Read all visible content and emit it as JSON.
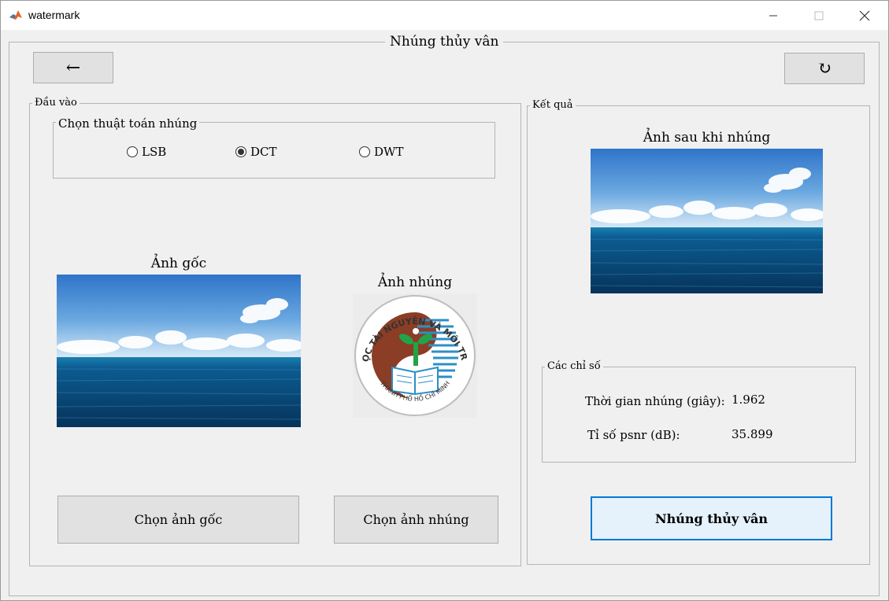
{
  "window": {
    "title": "watermark"
  },
  "main": {
    "title": "Nhúng thủy vân",
    "back_glyph": "←",
    "refresh_glyph": "↻"
  },
  "input_panel": {
    "title": "Đầu vào",
    "algorithm_group": {
      "title": "Chọn thuật toán nhúng",
      "options": [
        "LSB",
        "DCT",
        "DWT"
      ],
      "selected": "DCT"
    },
    "original_caption": "Ảnh gốc",
    "watermark_caption": "Ảnh nhúng",
    "logo_text_top": "ĐẠI HỌC TÀI NGUYÊN VÀ MÔI TRƯỜNG",
    "logo_text_bottom": "THÀNH PHỐ HỒ CHÍ MINH",
    "choose_original_label": "Chọn ảnh gốc",
    "choose_watermark_label": "Chọn ảnh nhúng"
  },
  "result_panel": {
    "title": "Kết quả",
    "result_caption": "Ảnh sau khi nhúng",
    "metrics_group": {
      "title": "Các chỉ số",
      "time_label": "Thời gian nhúng (giây):",
      "time_value": "1.962",
      "psnr_label": "Tỉ số psnr (dB):",
      "psnr_value": "35.899"
    },
    "embed_button_label": "Nhúng thủy vân"
  },
  "colors": {
    "sky_top": "#2f7ed3",
    "sky_bottom": "#cfe4f5",
    "sea": "#0d4f86",
    "logo_brown": "#8b3d26",
    "logo_blue": "#2b8fc7",
    "logo_green": "#22a34a",
    "primary_button_bg": "#e5f1fb",
    "primary_button_border": "#0078d7"
  }
}
